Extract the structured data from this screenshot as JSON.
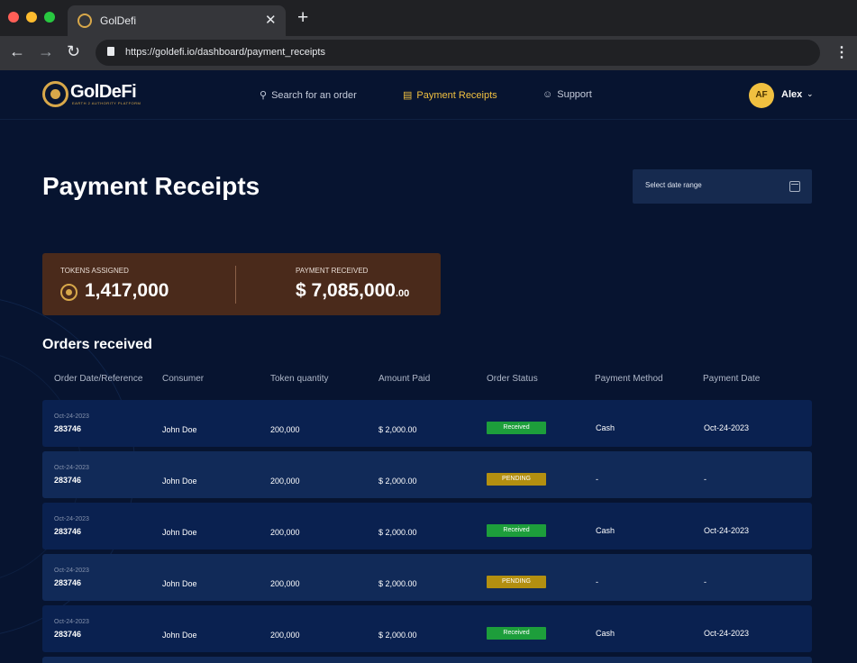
{
  "browser": {
    "tab_title": "GolDefi",
    "close_glyph": "✕",
    "new_tab_glyph": "+",
    "url": "https://goldefi.io/dashboard/payment_receipts"
  },
  "header": {
    "logo_text": "GolDeFi",
    "logo_tagline": "EARTH 2 AUTHORITY PLATFORM",
    "nav": [
      {
        "label": "Search for an order",
        "icon": "search-icon"
      },
      {
        "label": "Payment Receipts",
        "icon": "wallet-icon",
        "active": true
      },
      {
        "label": "Support",
        "icon": "support-icon"
      }
    ],
    "user": {
      "initials": "AF",
      "name": "Alex"
    }
  },
  "page": {
    "title": "Payment Receipts",
    "date_range_placeholder": "Select date range"
  },
  "summary": {
    "tokens_label": "TOKENS ASSIGNED",
    "tokens_value": "1,417,000",
    "payment_label": "PAYMENT RECEIVED",
    "payment_value": "$ 7,085,000",
    "payment_cents": ".00"
  },
  "orders": {
    "title": "Orders received",
    "columns": [
      "Order Date/Reference",
      "Consumer",
      "Token quantity",
      "Amount Paid",
      "Order Status",
      "Payment Method",
      "Payment Date"
    ],
    "rows": [
      {
        "date": "Oct-24-2023",
        "ref": "283746",
        "consumer": "John Doe",
        "tokens": "200,000",
        "amount": "$ 2,000.00",
        "status": "Received",
        "method": "Cash",
        "paid_date": "Oct-24-2023"
      },
      {
        "date": "Oct-24-2023",
        "ref": "283746",
        "consumer": "John Doe",
        "tokens": "200,000",
        "amount": "$ 2,000.00",
        "status": "PENDING",
        "method": "-",
        "paid_date": "-"
      },
      {
        "date": "Oct-24-2023",
        "ref": "283746",
        "consumer": "John Doe",
        "tokens": "200,000",
        "amount": "$ 2,000.00",
        "status": "Received",
        "method": "Cash",
        "paid_date": "Oct-24-2023"
      },
      {
        "date": "Oct-24-2023",
        "ref": "283746",
        "consumer": "John Doe",
        "tokens": "200,000",
        "amount": "$ 2,000.00",
        "status": "PENDING",
        "method": "-",
        "paid_date": "-"
      },
      {
        "date": "Oct-24-2023",
        "ref": "283746",
        "consumer": "John Doe",
        "tokens": "200,000",
        "amount": "$ 2,000.00",
        "status": "Received",
        "method": "Cash",
        "paid_date": "Oct-24-2023"
      }
    ]
  },
  "colors": {
    "background": "#071430",
    "accent_gold": "#f0c040",
    "summary_card": "#4a2a1b",
    "received": "#1d9e3b",
    "pending": "#b38f10"
  }
}
